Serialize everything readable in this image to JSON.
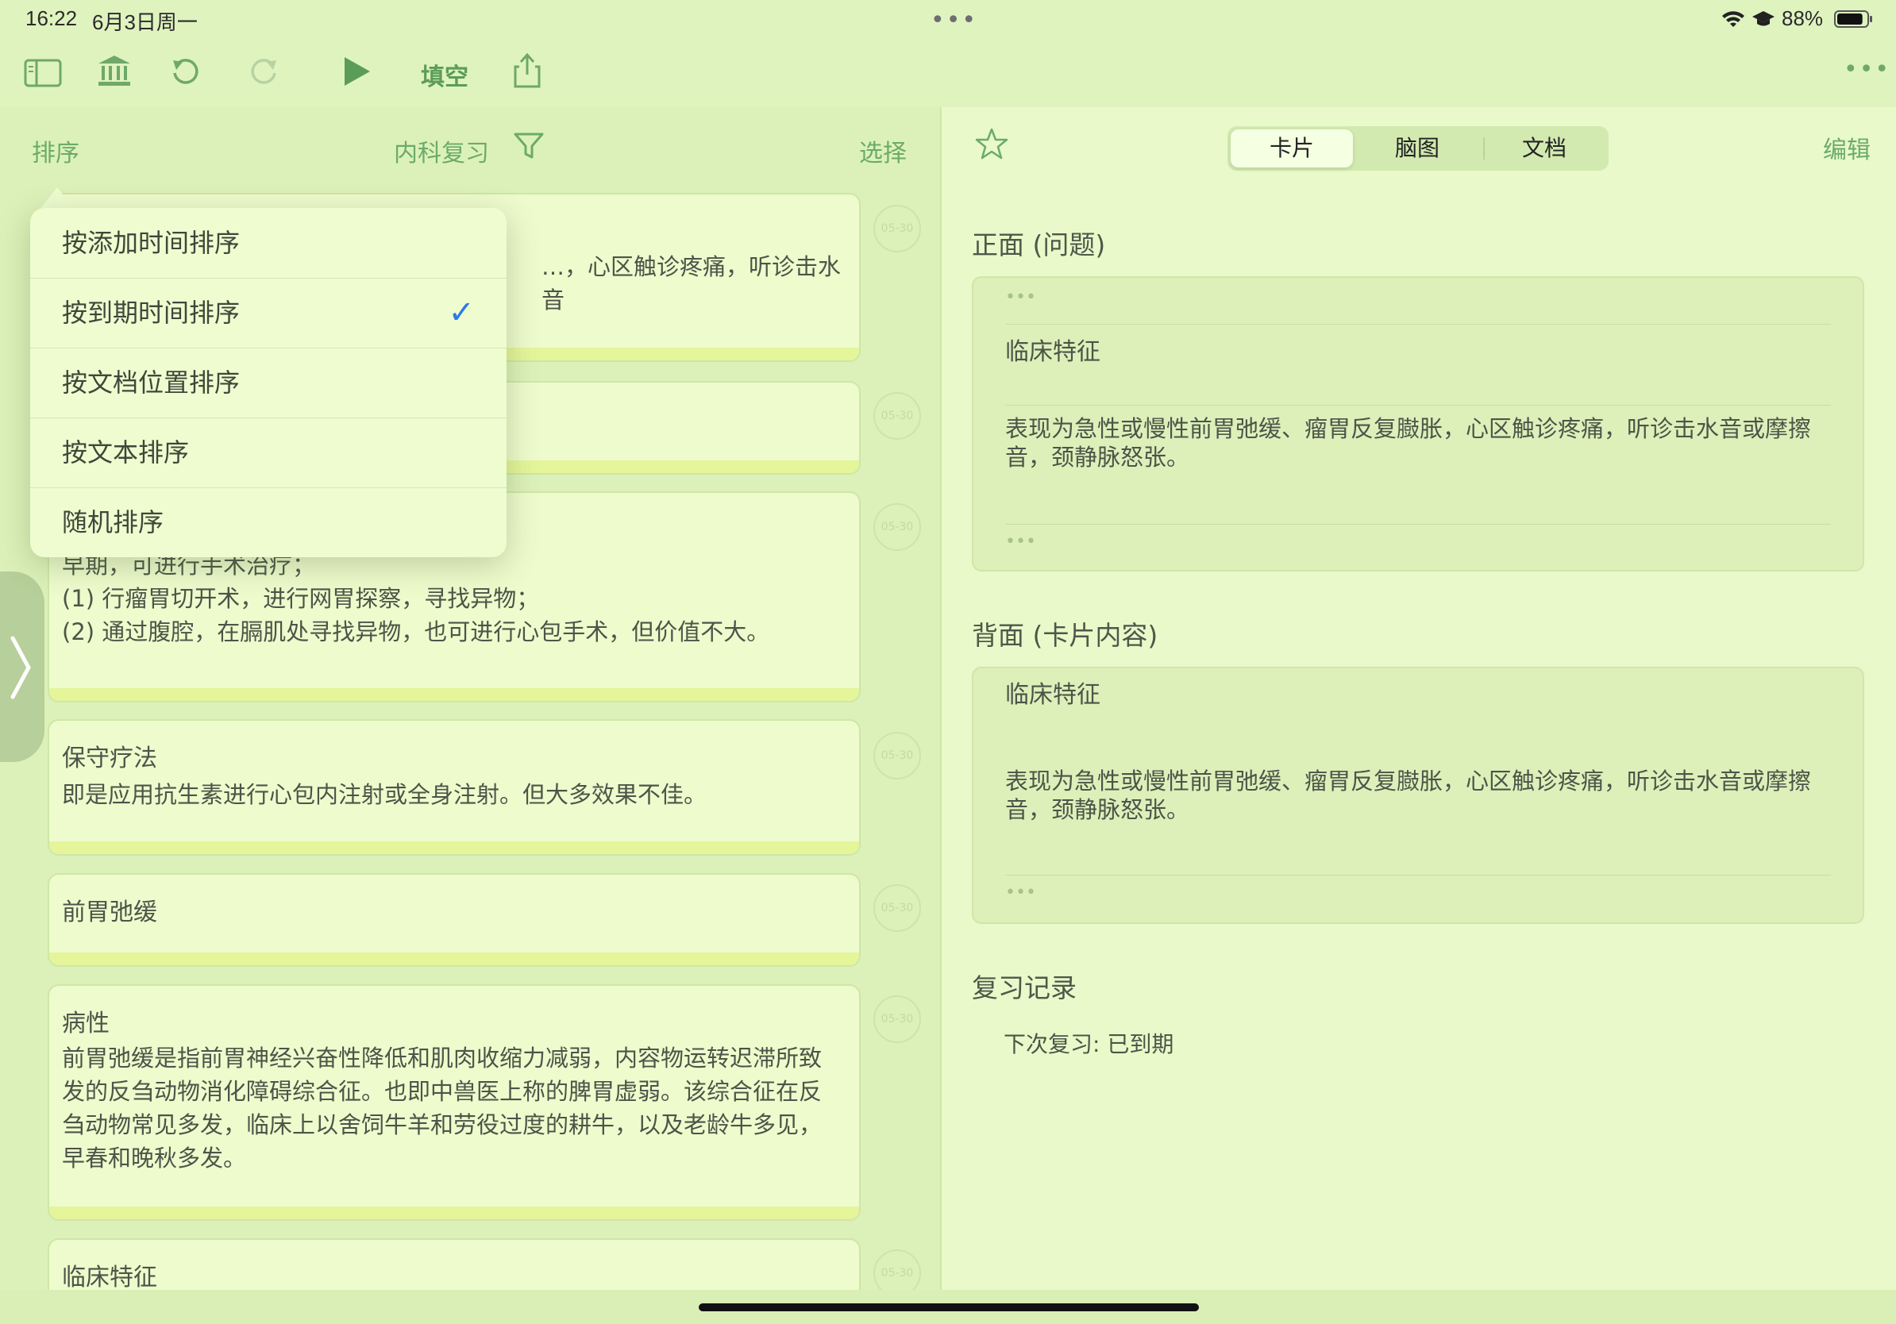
{
  "status_bar": {
    "time": "16:22",
    "date": "6月3日周一",
    "dots": "•••",
    "battery_percent": "88%",
    "battery_level": 0.88,
    "icons": [
      "wifi-icon",
      "graduation-cap-icon",
      "battery-icon"
    ]
  },
  "toolbar": {
    "icons": [
      "sidebar-icon",
      "library-icon",
      "undo-icon",
      "redo-icon",
      "play-icon",
      "share-icon",
      "more-icon"
    ],
    "fill_blank_label": "填空",
    "more": "•••"
  },
  "list_header": {
    "sort_label": "排序",
    "deck_label": "内科复习",
    "select_label": "选择"
  },
  "sort_menu": {
    "items": [
      {
        "label": "按添加时间排序",
        "checked": false
      },
      {
        "label": "按到期时间排序",
        "checked": true
      },
      {
        "label": "按文档位置排序",
        "checked": false
      },
      {
        "label": "按文本排序",
        "checked": false
      },
      {
        "label": "随机排序",
        "checked": false
      }
    ],
    "check_glyph": "✓"
  },
  "cards": [
    {
      "title": "",
      "body": "…，心区触诊疼痛，听诊击水音",
      "due": "05-30"
    },
    {
      "title": "",
      "body": "",
      "due": "05-30"
    },
    {
      "title": "",
      "body": "早期，可进行手术治疗；\n(1) 行瘤胃切开术，进行网胃探察，寻找异物；\n(2) 通过腹腔，在膈肌处寻找异物，也可进行心包手术，但价值不大。",
      "due": "05-30"
    },
    {
      "title": "保守疗法",
      "body": "即是应用抗生素进行心包内注射或全身注射。但大多效果不佳。",
      "due": "05-30"
    },
    {
      "title": "前胃弛缓",
      "body": "",
      "due": "05-30"
    },
    {
      "title": "病性",
      "body": "前胃弛缓是指前胃神经兴奋性降低和肌肉收缩力减弱，内容物运转迟滞所致发的反刍动物消化障碍综合征。也即中兽医上称的脾胃虚弱。该综合征在反刍动物常见多发，临床上以舍饲牛羊和劳役过度的耕牛，以及老龄牛多见，早春和晚秋多发。",
      "due": "05-30"
    },
    {
      "title": "临床特征",
      "body": "",
      "due": "05-30"
    }
  ],
  "detail": {
    "segments": [
      "卡片",
      "脑图",
      "文档"
    ],
    "active_segment": "卡片",
    "edit_label": "编辑",
    "front_heading": "正面 (问题)",
    "back_heading": "背面 (卡片内容)",
    "front": {
      "ellipsis": "•••",
      "title": "临床特征",
      "text": "表现为急性或慢性前胃弛缓、瘤胃反复臌胀，心区触诊疼痛，听诊击水音或摩擦音，颈静脉怒张。"
    },
    "back": {
      "ellipsis": "•••",
      "title": "临床特征",
      "text": "表现为急性或慢性前胃弛缓、瘤胃反复臌胀，心区触诊疼痛，听诊击水音或摩擦音，颈静脉怒张。"
    },
    "review_heading": "复习记录",
    "next_review": "下次复习: 已到期"
  },
  "colors": {
    "background": "#dff3bf",
    "accent_green": "#6bab6b",
    "check_blue": "#2d7be5",
    "card_bar": "#e4f59a"
  }
}
